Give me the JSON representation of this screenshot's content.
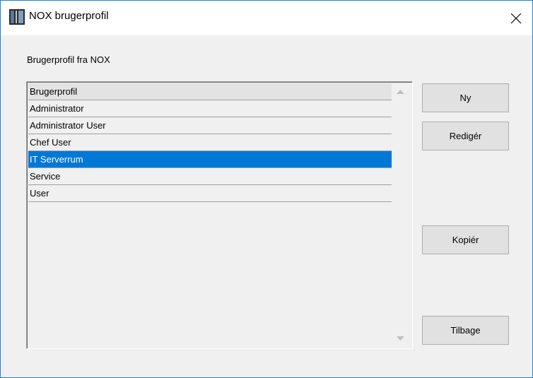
{
  "window": {
    "title": "NOX brugerprofil"
  },
  "group": {
    "label": "Brugerprofil fra NOX"
  },
  "list": {
    "header": "Brugerprofil",
    "items": [
      "Administrator",
      "Administrator User",
      "Chef User",
      "IT Serverrum",
      "Service",
      "User"
    ],
    "selected": "IT Serverrum"
  },
  "buttons": {
    "new": "Ny",
    "edit": "Redigér",
    "copy": "Kopiér",
    "back": "Tilbage"
  },
  "colors": {
    "selection": "#0078d7",
    "window_border": "#1883d7"
  }
}
